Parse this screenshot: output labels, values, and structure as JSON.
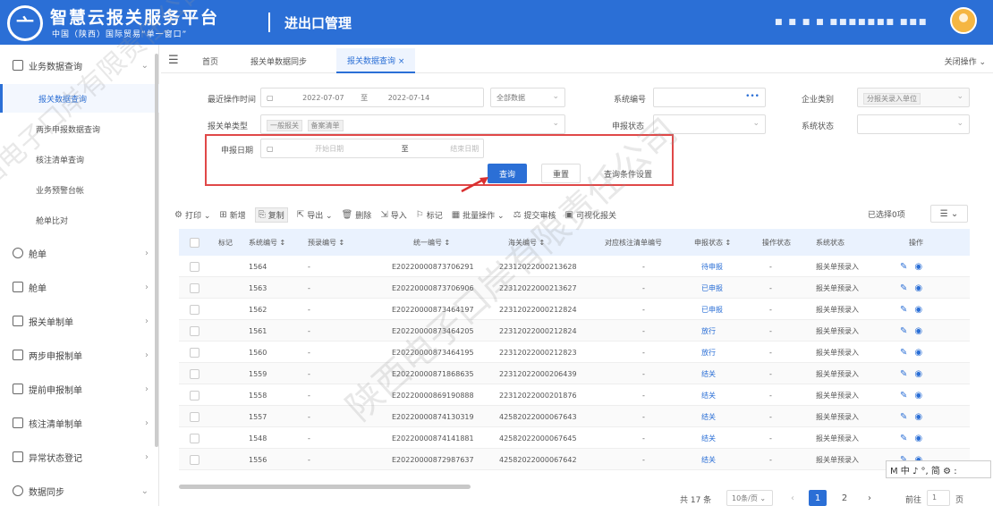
{
  "header": {
    "logo_glyph": "亠",
    "title": "智慧云报关服务平台",
    "subtitle": "中国（陕西）国际贸易“单一窗口”",
    "module": "进出口管理",
    "user_masked": "■ ■ ■ ■  ■■■■■■■ ■■■"
  },
  "sidebar": {
    "groups": [
      {
        "label": "业务数据查询",
        "icon": "chart-line-icon"
      },
      {
        "label": "舱单",
        "icon": "people-icon"
      },
      {
        "label": "舱单",
        "icon": "document-icon"
      },
      {
        "label": "报关单制单",
        "icon": "doc-edit-icon"
      },
      {
        "label": "两步申报制单",
        "icon": "doc-edit-icon"
      },
      {
        "label": "提前申报制单",
        "icon": "doc-edit-icon"
      },
      {
        "label": "核注清单制单",
        "icon": "doc-edit-icon"
      },
      {
        "label": "异常状态登记",
        "icon": "clipboard-icon"
      },
      {
        "label": "数据同步",
        "icon": "sync-icon"
      }
    ],
    "subitems": [
      {
        "label": "报关数据查询",
        "active": true
      },
      {
        "label": "两步申报数据查询",
        "active": false
      },
      {
        "label": "核注清单查询",
        "active": false
      },
      {
        "label": "业务预警台帐",
        "active": false
      },
      {
        "label": "舱单比对",
        "active": false
      }
    ],
    "collapse_arrow": "⌄",
    "expand_arrow": "›"
  },
  "tabs": {
    "menu_icon": "☰",
    "items": [
      "首页",
      "报关单数据同步",
      "报关数据查询 ×"
    ],
    "close_all": "关闭操作 ⌄"
  },
  "filters": {
    "apply_date_label": "最近操作时间",
    "date_start": "2022-07-07",
    "date_to": "至",
    "date_end": "2022-07-14",
    "data_scope": "全部数据",
    "sys_no_label": "系统编号",
    "sys_no_dots": "•••",
    "company_type_label": "企业类别",
    "company_type_value": "分报关录入单位",
    "decl_type_label": "报关单类型",
    "decl_type_tags": [
      "一般报关",
      "备案清单"
    ],
    "declare_status_label": "申报状态",
    "system_status_label": "系统状态",
    "declare_date_label": "申报日期",
    "declare_start_ph": "开始日期",
    "declare_to": "至",
    "declare_end_ph": "结束日期",
    "query_btn": "查询",
    "reset_btn": "重置",
    "cond_btn": "查询条件设置"
  },
  "toolbar": {
    "items": [
      {
        "glyph": "⚙",
        "label": "打印 ⌄"
      },
      {
        "glyph": "⊞",
        "label": "新增"
      },
      {
        "glyph": "⎘",
        "label": "复制"
      },
      {
        "glyph": "⇱",
        "label": "导出 ⌄"
      },
      {
        "glyph": "🗑",
        "label": "删除"
      },
      {
        "glyph": "⇲",
        "label": "导入"
      },
      {
        "glyph": "⚐",
        "label": "标记"
      },
      {
        "glyph": "▦",
        "label": "批量操作 ⌄"
      },
      {
        "glyph": "⚖",
        "label": "提交审核"
      },
      {
        "glyph": "▣",
        "label": "可视化报关"
      }
    ],
    "selected": "已选择0项",
    "col_toggle": "☰ ⌄"
  },
  "table": {
    "headers": [
      "标记",
      "系统编号 ↕",
      "预录编号 ↕",
      "统一编号 ↕",
      "海关编号 ↕",
      "对应核注清单编号",
      "申报状态 ↕",
      "操作状态",
      "系统状态",
      "操作"
    ],
    "rows": [
      {
        "mark": "",
        "sysno": "1564",
        "preno": "-",
        "uniq": "E20220000873706291",
        "customs": "22312022000213628",
        "corr": "-",
        "status": "待申报",
        "opstat": "-",
        "sys": "报关单预录入"
      },
      {
        "mark": "",
        "sysno": "1563",
        "preno": "-",
        "uniq": "E20220000873706906",
        "customs": "22312022000213627",
        "corr": "-",
        "status": "已申报",
        "opstat": "-",
        "sys": "报关单预录入"
      },
      {
        "mark": "",
        "sysno": "1562",
        "preno": "-",
        "uniq": "E20220000873464197",
        "customs": "22312022000212824",
        "corr": "-",
        "status": "已申报",
        "opstat": "-",
        "sys": "报关单预录入"
      },
      {
        "mark": "",
        "sysno": "1561",
        "preno": "-",
        "uniq": "E20220000873464205",
        "customs": "22312022000212824",
        "corr": "-",
        "status": "放行",
        "opstat": "-",
        "sys": "报关单预录入"
      },
      {
        "mark": "",
        "sysno": "1560",
        "preno": "-",
        "uniq": "E20220000873464195",
        "customs": "22312022000212823",
        "corr": "-",
        "status": "放行",
        "opstat": "-",
        "sys": "报关单预录入"
      },
      {
        "mark": "",
        "sysno": "1559",
        "preno": "-",
        "uniq": "E20220000871868635",
        "customs": "22312022000206439",
        "corr": "-",
        "status": "结关",
        "opstat": "-",
        "sys": "报关单预录入"
      },
      {
        "mark": "",
        "sysno": "1558",
        "preno": "-",
        "uniq": "E20220000869190888",
        "customs": "22312022000201876",
        "corr": "-",
        "status": "结关",
        "opstat": "-",
        "sys": "报关单预录入"
      },
      {
        "mark": "",
        "sysno": "1557",
        "preno": "-",
        "uniq": "E20220000874130319",
        "customs": "42582022000067643",
        "corr": "-",
        "status": "结关",
        "opstat": "-",
        "sys": "报关单预录入"
      },
      {
        "mark": "",
        "sysno": "1548",
        "preno": "-",
        "uniq": "E20220000874141881",
        "customs": "42582022000067645",
        "corr": "-",
        "status": "结关",
        "opstat": "-",
        "sys": "报关单预录入"
      },
      {
        "mark": "",
        "sysno": "1556",
        "preno": "-",
        "uniq": "E20220000872987637",
        "customs": "42582022000067642",
        "corr": "-",
        "status": "结关",
        "opstat": "-",
        "sys": "报关单预录入"
      }
    ]
  },
  "pagination": {
    "total": "共 17 条",
    "page_size": "10条/页 ⌄",
    "prev": "‹",
    "pages": [
      "1",
      "2"
    ],
    "next": "›",
    "goto": "前往",
    "goto_page": "1",
    "goto_suffix": "页"
  },
  "ime": "M 中 ♪ °, 简 ⚙ :",
  "watermark": "陕西电子口岸有限责任公司"
}
